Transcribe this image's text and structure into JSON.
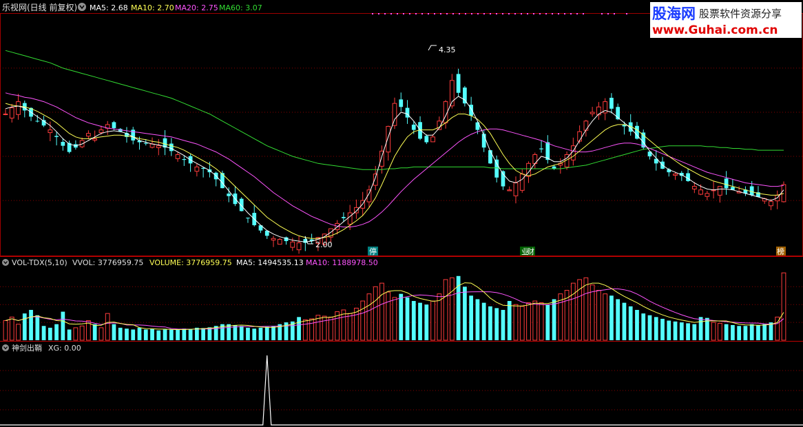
{
  "header": {
    "app_title": "乐视网(日线 前复权)",
    "ma5": "MA5: 2.68",
    "ma10": "MA10: 2.70",
    "ma20": "MA20: 2.75",
    "ma60": "MA60: 3.07"
  },
  "watermark": {
    "brand": "股海网",
    "tagline": "股票软件资源分享",
    "url": "www.Guhai.com.cn"
  },
  "volume_panel": {
    "indicator": "VOL-TDX(5,10)",
    "vvol": "VVOL: 3776959.75",
    "volume": "VOLUME: 3776959.75",
    "ma5": "MA5: 1494535.13",
    "ma10": "MA10: 1188978.50"
  },
  "signal_panel": {
    "indicator": "神剑出鞘",
    "xg": "XG: 0.00"
  },
  "markers": {
    "peak": "4.35",
    "trough": "2.00",
    "tag_stop": "停",
    "tag_finance": "财",
    "tag_list": "榜"
  },
  "colors": {
    "up": "#ff3c3c",
    "down": "#54ffff",
    "ma5": "#ffffff",
    "ma10": "#ffff55",
    "ma20": "#ff55ff",
    "ma60": "#33dd33",
    "grid": "#8b0000"
  },
  "chart_data": [
    {
      "type": "candlestick",
      "name": "price",
      "ylim": [
        1.9,
        4.6
      ],
      "gridlines": [
        4.0,
        3.5,
        3.0,
        2.5
      ],
      "close": [
        3.48,
        3.55,
        3.62,
        3.52,
        3.45,
        3.4,
        3.35,
        3.3,
        3.22,
        3.12,
        3.05,
        3.1,
        3.18,
        3.26,
        3.2,
        3.3,
        3.36,
        3.32,
        3.28,
        3.22,
        3.18,
        3.16,
        3.15,
        3.14,
        3.12,
        3.1,
        3.06,
        3.02,
        2.96,
        2.92,
        2.88,
        2.86,
        2.82,
        2.74,
        2.64,
        2.55,
        2.46,
        2.38,
        2.3,
        2.22,
        2.16,
        2.1,
        2.07,
        2.06,
        2.04,
        2.03,
        2.02,
        2.02,
        2.04,
        2.08,
        2.12,
        2.18,
        2.24,
        2.3,
        2.36,
        2.42,
        2.5,
        2.62,
        2.8,
        3.06,
        3.34,
        3.6,
        3.56,
        3.44,
        3.3,
        3.2,
        3.16,
        3.22,
        3.4,
        3.62,
        3.86,
        3.72,
        3.6,
        3.46,
        3.3,
        3.1,
        2.92,
        2.76,
        2.66,
        2.62,
        2.7,
        2.8,
        2.92,
        3.02,
        3.08,
        2.96,
        2.86,
        2.92,
        3.02,
        3.12,
        3.28,
        3.4,
        3.5,
        3.56,
        3.62,
        3.54,
        3.42,
        3.34,
        3.28,
        3.2,
        3.1,
        3.0,
        2.92,
        2.86,
        2.82,
        2.8,
        2.78,
        2.72,
        2.66,
        2.62,
        2.58,
        2.62,
        2.66,
        2.64,
        2.62,
        2.6,
        2.58,
        2.56,
        2.54,
        2.52,
        2.49,
        2.56,
        2.68
      ],
      "ma5": [
        3.54,
        3.56,
        3.57,
        3.55,
        3.5,
        3.45,
        3.4,
        3.35,
        3.28,
        3.2,
        3.14,
        3.12,
        3.14,
        3.18,
        3.22,
        3.26,
        3.28,
        3.29,
        3.28,
        3.26,
        3.22,
        3.18,
        3.16,
        3.14,
        3.13,
        3.11,
        3.09,
        3.05,
        3.01,
        2.96,
        2.92,
        2.88,
        2.84,
        2.78,
        2.7,
        2.61,
        2.52,
        2.44,
        2.36,
        2.29,
        2.22,
        2.16,
        2.12,
        2.09,
        2.07,
        2.05,
        2.04,
        2.03,
        2.04,
        2.06,
        2.09,
        2.14,
        2.2,
        2.26,
        2.32,
        2.38,
        2.46,
        2.58,
        2.76,
        3.0,
        3.22,
        3.42,
        3.5,
        3.48,
        3.4,
        3.3,
        3.24,
        3.24,
        3.32,
        3.46,
        3.62,
        3.68,
        3.64,
        3.54,
        3.4,
        3.24,
        3.06,
        2.92,
        2.8,
        2.72,
        2.7,
        2.74,
        2.82,
        2.92,
        3.0,
        2.98,
        2.94,
        2.94,
        2.98,
        3.06,
        3.18,
        3.3,
        3.4,
        3.48,
        3.52,
        3.5,
        3.44,
        3.38,
        3.32,
        3.24,
        3.16,
        3.06,
        2.98,
        2.9,
        2.85,
        2.82,
        2.79,
        2.75,
        2.7,
        2.66,
        2.63,
        2.62,
        2.63,
        2.63,
        2.62,
        2.6,
        2.58,
        2.56,
        2.54,
        2.52,
        2.5,
        2.53,
        2.62
      ],
      "ma10": [
        3.6,
        3.58,
        3.57,
        3.56,
        3.54,
        3.51,
        3.47,
        3.43,
        3.38,
        3.32,
        3.26,
        3.22,
        3.2,
        3.2,
        3.21,
        3.22,
        3.23,
        3.24,
        3.24,
        3.23,
        3.22,
        3.2,
        3.19,
        3.17,
        3.16,
        3.14,
        3.12,
        3.1,
        3.07,
        3.03,
        2.99,
        2.95,
        2.91,
        2.86,
        2.8,
        2.73,
        2.66,
        2.59,
        2.52,
        2.45,
        2.38,
        2.31,
        2.26,
        2.21,
        2.17,
        2.13,
        2.1,
        2.08,
        2.07,
        2.07,
        2.08,
        2.1,
        2.13,
        2.17,
        2.22,
        2.27,
        2.33,
        2.42,
        2.53,
        2.68,
        2.84,
        3.0,
        3.12,
        3.22,
        3.28,
        3.3,
        3.3,
        3.3,
        3.33,
        3.38,
        3.44,
        3.48,
        3.48,
        3.46,
        3.42,
        3.35,
        3.26,
        3.14,
        3.02,
        2.92,
        2.84,
        2.8,
        2.78,
        2.8,
        2.84,
        2.88,
        2.9,
        2.92,
        2.96,
        3.0,
        3.06,
        3.12,
        3.18,
        3.24,
        3.3,
        3.34,
        3.36,
        3.36,
        3.34,
        3.3,
        3.24,
        3.18,
        3.12,
        3.06,
        3.0,
        2.95,
        2.9,
        2.86,
        2.82,
        2.78,
        2.75,
        2.72,
        2.7,
        2.68,
        2.66,
        2.64,
        2.62,
        2.6,
        2.58,
        2.57,
        2.56,
        2.56,
        2.58
      ],
      "ma20": [
        3.72,
        3.7,
        3.69,
        3.67,
        3.66,
        3.64,
        3.62,
        3.59,
        3.56,
        3.52,
        3.48,
        3.44,
        3.41,
        3.38,
        3.36,
        3.34,
        3.32,
        3.31,
        3.3,
        3.29,
        3.28,
        3.27,
        3.26,
        3.25,
        3.24,
        3.23,
        3.22,
        3.2,
        3.18,
        3.16,
        3.14,
        3.11,
        3.08,
        3.05,
        3.01,
        2.97,
        2.92,
        2.87,
        2.82,
        2.77,
        2.71,
        2.65,
        2.59,
        2.54,
        2.49,
        2.44,
        2.4,
        2.36,
        2.32,
        2.29,
        2.26,
        2.23,
        2.21,
        2.2,
        2.2,
        2.21,
        2.23,
        2.26,
        2.31,
        2.37,
        2.44,
        2.52,
        2.6,
        2.67,
        2.74,
        2.8,
        2.86,
        2.92,
        2.98,
        3.04,
        3.1,
        3.16,
        3.21,
        3.25,
        3.28,
        3.3,
        3.31,
        3.31,
        3.3,
        3.28,
        3.26,
        3.24,
        3.22,
        3.2,
        3.18,
        3.15,
        3.12,
        3.1,
        3.08,
        3.06,
        3.05,
        3.05,
        3.06,
        3.08,
        3.1,
        3.12,
        3.14,
        3.15,
        3.15,
        3.14,
        3.12,
        3.09,
        3.06,
        3.03,
        3.0,
        2.97,
        2.94,
        2.91,
        2.88,
        2.85,
        2.82,
        2.8,
        2.78,
        2.76,
        2.74,
        2.72,
        2.7,
        2.69,
        2.68,
        2.67,
        2.66,
        2.66,
        2.67
      ],
      "ma60": [
        4.2,
        4.18,
        4.16,
        4.14,
        4.12,
        4.1,
        4.08,
        4.06,
        4.03,
        4.0,
        3.98,
        3.96,
        3.94,
        3.92,
        3.9,
        3.88,
        3.86,
        3.84,
        3.82,
        3.8,
        3.78,
        3.76,
        3.74,
        3.72,
        3.7,
        3.68,
        3.66,
        3.63,
        3.6,
        3.57,
        3.54,
        3.51,
        3.48,
        3.44,
        3.4,
        3.36,
        3.32,
        3.28,
        3.24,
        3.2,
        3.16,
        3.12,
        3.09,
        3.06,
        3.03,
        3.0,
        2.98,
        2.96,
        2.94,
        2.92,
        2.91,
        2.9,
        2.89,
        2.88,
        2.87,
        2.86,
        2.85,
        2.85,
        2.85,
        2.85,
        2.86,
        2.86,
        2.87,
        2.87,
        2.88,
        2.88,
        2.88,
        2.88,
        2.88,
        2.88,
        2.88,
        2.88,
        2.88,
        2.88,
        2.88,
        2.88,
        2.87,
        2.87,
        2.86,
        2.86,
        2.86,
        2.86,
        2.86,
        2.86,
        2.86,
        2.86,
        2.86,
        2.86,
        2.87,
        2.88,
        2.89,
        2.9,
        2.92,
        2.94,
        2.96,
        2.98,
        3.0,
        3.02,
        3.04,
        3.06,
        3.08,
        3.09,
        3.1,
        3.11,
        3.12,
        3.12,
        3.12,
        3.12,
        3.12,
        3.12,
        3.11,
        3.11,
        3.1,
        3.1,
        3.09,
        3.09,
        3.08,
        3.08,
        3.07,
        3.07,
        3.07,
        3.07,
        3.07
      ]
    },
    {
      "type": "bar",
      "name": "volume",
      "ylim": [
        0,
        3900000
      ],
      "values": [
        1100000,
        1300000,
        900000,
        1500000,
        1700000,
        1400000,
        800000,
        700000,
        900000,
        1600000,
        600000,
        700000,
        800000,
        1100000,
        900000,
        700000,
        1500000,
        900000,
        700000,
        650000,
        600000,
        700000,
        600000,
        650000,
        550000,
        600000,
        620000,
        580000,
        650000,
        620000,
        700000,
        680000,
        720000,
        800000,
        900000,
        900000,
        850000,
        800000,
        700000,
        650000,
        700000,
        750000,
        800000,
        900000,
        1000000,
        1050000,
        1300000,
        1150000,
        1200000,
        1400000,
        1350000,
        1300000,
        1600000,
        1700000,
        1500000,
        1800000,
        2200000,
        2600000,
        3000000,
        3200000,
        2700000,
        2400000,
        2600000,
        2400000,
        2200000,
        2100000,
        2000000,
        2200000,
        2600000,
        3400000,
        3500000,
        3600000,
        3000000,
        2500000,
        2300000,
        2100000,
        1900000,
        1800000,
        1700000,
        2200000,
        2000000,
        1900000,
        2100000,
        2200000,
        2100000,
        2000000,
        2300000,
        2600000,
        2800000,
        3200000,
        3400000,
        3500000,
        3100000,
        2800000,
        2600000,
        2500000,
        2300000,
        2100000,
        1900000,
        1700000,
        1500000,
        1400000,
        1300000,
        1200000,
        1100000,
        1050000,
        1000000,
        950000,
        900000,
        1300000,
        1250000,
        1000000,
        950000,
        900000,
        850000,
        800000,
        800000,
        900000,
        850000,
        900000,
        1000000,
        1300000,
        3776959.75
      ]
    },
    {
      "type": "line",
      "name": "xg",
      "ylim": [
        0,
        1
      ],
      "spike_index": 41,
      "values": []
    }
  ]
}
